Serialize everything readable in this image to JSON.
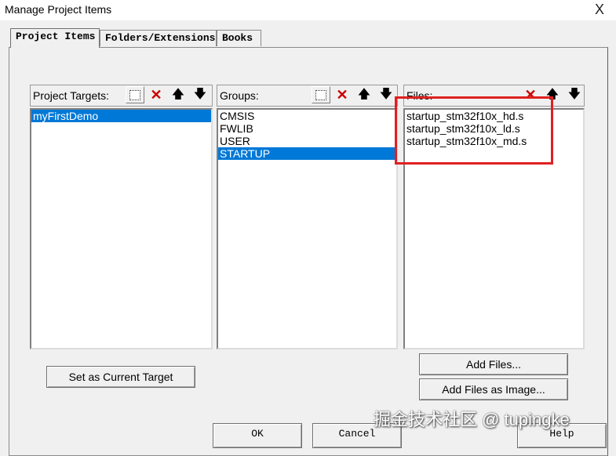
{
  "window": {
    "title": "Manage Project Items",
    "close": "X"
  },
  "tabs": [
    {
      "label": "Project Items",
      "active": true
    },
    {
      "label": "Folders/Extensions",
      "active": false
    },
    {
      "label": "Books",
      "active": false
    }
  ],
  "targets": {
    "label": "Project Targets:",
    "items": [
      "myFirstDemo"
    ],
    "selected": 0
  },
  "groups": {
    "label": "Groups:",
    "items": [
      "CMSIS",
      "FWLIB",
      "USER",
      "STARTUP"
    ],
    "selected": 3
  },
  "files": {
    "label": "Files:",
    "items": [
      "startup_stm32f10x_hd.s",
      "startup_stm32f10x_ld.s",
      "startup_stm32f10x_md.s"
    ]
  },
  "buttons": {
    "set_target": "Set as Current Target",
    "add_files": "Add Files...",
    "add_image": "Add Files as Image...",
    "ok": "OK",
    "cancel": "Cancel",
    "help": "Help"
  },
  "icons": {
    "new": "new-item-icon",
    "delete": "delete-icon",
    "up": "move-up-icon",
    "down": "move-down-icon"
  },
  "colors": {
    "selection": "#0078d7",
    "highlight_border": "#e02020"
  },
  "watermark": "掘金技术社区 @ tupingke"
}
